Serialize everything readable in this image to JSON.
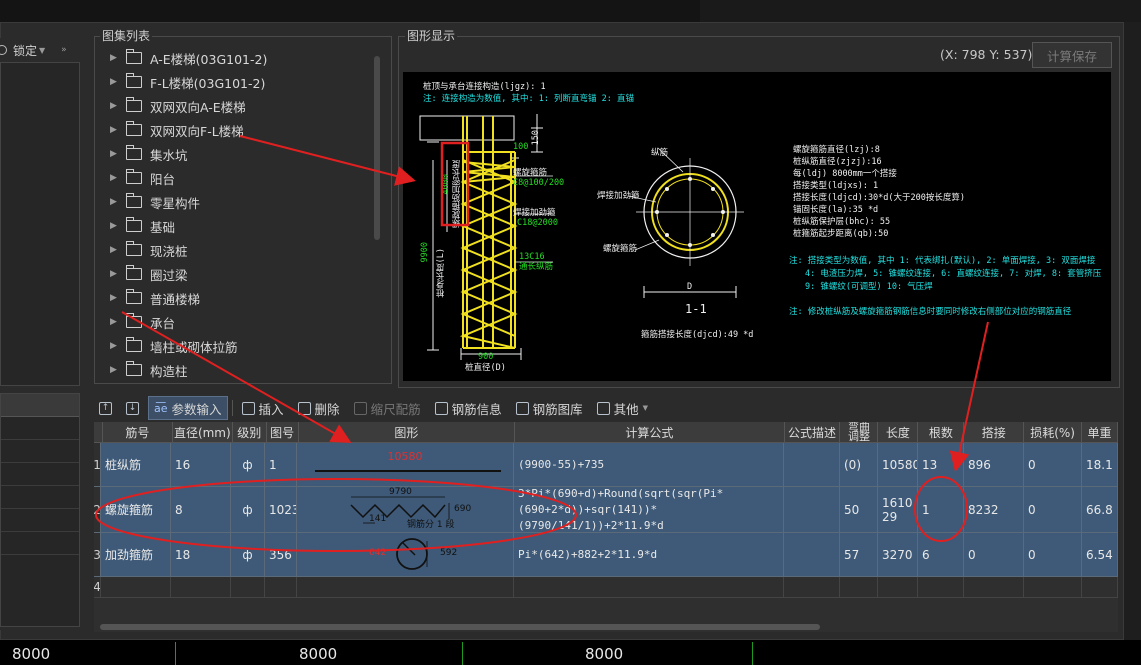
{
  "left": {
    "lock_label": "锁定"
  },
  "atlas": {
    "title": "图集列表",
    "items": [
      {
        "label": "A-E楼梯(03G101-2)"
      },
      {
        "label": "F-L楼梯(03G101-2)"
      },
      {
        "label": "双网双向A-E楼梯"
      },
      {
        "label": "双网双向F-L楼梯"
      },
      {
        "label": "集水坑"
      },
      {
        "label": "阳台"
      },
      {
        "label": "零星构件"
      },
      {
        "label": "基础"
      },
      {
        "label": "现浇桩"
      },
      {
        "label": "圈过梁"
      },
      {
        "label": "普通楼梯"
      },
      {
        "label": "承台"
      },
      {
        "label": "墙柱或砌体拉筋"
      },
      {
        "label": "构造柱"
      }
    ]
  },
  "graphic": {
    "title": "图形显示",
    "coords": "(X: 798 Y: 537)",
    "calc_save": "计算保存",
    "cad": {
      "line1": "桩顶与承台连接构造(ljgz): 1",
      "line2": "注: 连接构造为数值, 其中: 1: 列断直弯锚      2: 直锚",
      "label_100": "100",
      "label_150": "150",
      "label_4000": "4000",
      "side_text": "螺旋箍筋加密长度",
      "luoxuan": "螺旋箍筋",
      "c8": "C8@100/200",
      "jiajin": "焊接加劲箍",
      "c18": "C18@2000",
      "c16": "13C16",
      "tongchang": "通长纵筋",
      "label_9900": "9900",
      "zhuchang": "桩身长度(L)",
      "label_900": "900",
      "zhujing": "桩直径(D)",
      "zongjin": "纵筋",
      "jiajin2": "焊接加劲箍",
      "luoxuan2": "螺旋箍筋",
      "label_D": "D",
      "section": "1-1",
      "djcd": "箍筋搭接长度(djcd):49 *d",
      "p1": "螺旋箍筋直径(lzj):8",
      "p2": "桩纵筋直径(zjzj):16",
      "p3": "每(ldj) 8000mm一个搭接",
      "p4": "搭接类型(ldjxs): 1",
      "p5": "搭接长度(ldjcd):30*d(大于200按长度算)",
      "p6": "锚固长度(la):35 *d",
      "p7": "桩纵筋保护层(bhc): 55",
      "p8": "桩箍筋起步距离(qb):50",
      "n1": "注: 搭接类型为数值, 其中 1: 代表绑扎(默认), 2: 单面焊接, 3: 双面焊接",
      "n2": "4: 电渣压力焊, 5: 锥螺纹连接, 6: 直螺纹连接, 7: 对焊, 8: 套管挤压",
      "n3": "9: 锥螺纹(可调型)  10: 气压焊",
      "n4": "注: 修改桩纵筋及螺旋箍筋钢筋信息时要同时修改右侧部位对应的钢筋直径"
    }
  },
  "toolbar": {
    "up": "↑",
    "down": "↓",
    "param": "参数输入",
    "insert": "插入",
    "delete": "删除",
    "scale": "缩尺配筋",
    "rebar_info": "钢筋信息",
    "rebar_lib": "钢筋图库",
    "other": "其他"
  },
  "table": {
    "headers": [
      "",
      "筋号",
      "直径(mm)",
      "级别",
      "图号",
      "图形",
      "计算公式",
      "公式描述",
      "弯曲调整",
      "长度",
      "根数",
      "搭接",
      "损耗(%)",
      "单重"
    ],
    "rows": [
      {
        "idx": "1",
        "name": "桩纵筋",
        "dia": "16",
        "grade": "ф",
        "fig": "1",
        "shape_len": "10580",
        "formula": "(9900-55)+735",
        "desc": "",
        "bend": "(0)",
        "length": "10580",
        "count": "13",
        "lap": "896",
        "loss": "0",
        "weight": "18.1"
      },
      {
        "idx": "2",
        "name": "螺旋箍筋",
        "dia": "8",
        "grade": "ф",
        "fig": "1023",
        "shape_w": "9790",
        "shape_h": "690",
        "shape_pitch": "141",
        "shape_note": "钢筋分 1 段",
        "formula": "3*Pi*(690+d)+Round(sqrt(sqr(Pi*(690+2*d))+sqr(141))*(9790/141/1))+2*11.9*d",
        "desc": "",
        "bend": "50",
        "length": "161029",
        "count": "1",
        "lap": "8232",
        "loss": "0",
        "weight": "66.8"
      },
      {
        "idx": "3",
        "name": "加劲箍筋",
        "dia": "18",
        "grade": "ф",
        "fig": "356",
        "shape_d": "642",
        "shape_w": "592",
        "formula": "Pi*(642)+882+2*11.9*d",
        "desc": "",
        "bend": "57",
        "length": "3270",
        "count": "6",
        "lap": "0",
        "loss": "0",
        "weight": "6.54"
      },
      {
        "idx": "4"
      }
    ]
  },
  "bottom": {
    "n1": "8000",
    "n2": "8000",
    "n3": "8000"
  },
  "colors": {
    "annotation": "#e02020",
    "row_bg": "#3e5a78",
    "cad_yellow": "#f0e020"
  }
}
